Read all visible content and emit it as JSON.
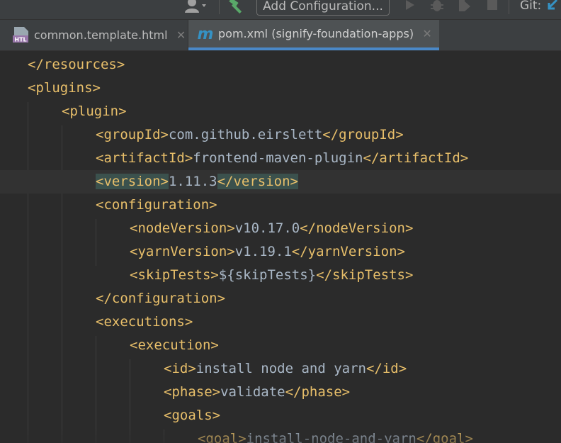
{
  "toolbar": {
    "add_configuration_label": "Add Configuration...",
    "git_label": "Git:",
    "icons": {
      "user": "user-icon",
      "build": "hammer-icon",
      "run": "run-icon",
      "debug": "debug-icon",
      "coverage": "coverage-icon",
      "stop": "stop-icon",
      "vcs_update": "vcs-update-icon"
    }
  },
  "tabs": [
    {
      "label": "common.template.html",
      "icon": "html-file-icon",
      "icon_text": "HTL",
      "active": false
    },
    {
      "label": "pom.xml (signify-foundation-apps)",
      "icon": "maven-file-icon",
      "icon_text": "m",
      "active": true
    }
  ],
  "editor": {
    "lines": [
      {
        "indent": 0,
        "open": "</resources>",
        "text": "",
        "close": ""
      },
      {
        "indent": 0,
        "open": "<plugins>",
        "text": "",
        "close": ""
      },
      {
        "indent": 1,
        "open": "<plugin>",
        "text": "",
        "close": ""
      },
      {
        "indent": 2,
        "open": "<groupId>",
        "text": "com.github.eirslett",
        "close": "</groupId>"
      },
      {
        "indent": 2,
        "open": "<artifactId>",
        "text": "frontend-maven-plugin",
        "close": "</artifactId>"
      },
      {
        "indent": 2,
        "open": "<version>",
        "text": "1.11.3",
        "close": "</version>",
        "current": true
      },
      {
        "indent": 2,
        "open": "<configuration>",
        "text": "",
        "close": ""
      },
      {
        "indent": 3,
        "open": "<nodeVersion>",
        "text": "v10.17.0",
        "close": "</nodeVersion>"
      },
      {
        "indent": 3,
        "open": "<yarnVersion>",
        "text": "v1.19.1",
        "close": "</yarnVersion>"
      },
      {
        "indent": 3,
        "open": "<skipTests>",
        "text": "${skipTests}",
        "close": "</skipTests>"
      },
      {
        "indent": 2,
        "open": "</configuration>",
        "text": "",
        "close": ""
      },
      {
        "indent": 2,
        "open": "<executions>",
        "text": "",
        "close": ""
      },
      {
        "indent": 3,
        "open": "<execution>",
        "text": "",
        "close": ""
      },
      {
        "indent": 4,
        "open": "<id>",
        "text": "install node and yarn",
        "close": "</id>"
      },
      {
        "indent": 4,
        "open": "<phase>",
        "text": "validate",
        "close": "</phase>"
      },
      {
        "indent": 4,
        "open": "<goals>",
        "text": "",
        "close": ""
      },
      {
        "indent": 5,
        "open": "<goal>",
        "text": "install-node-and-yarn",
        "close": "</goal>"
      }
    ]
  },
  "colors": {
    "background": "#2b2b2b",
    "tag": "#e8bf6a",
    "text": "#a9b7c6",
    "current_line": "#323232",
    "tag_match": "#3b514d",
    "tab_accent": "#4a88c7"
  }
}
